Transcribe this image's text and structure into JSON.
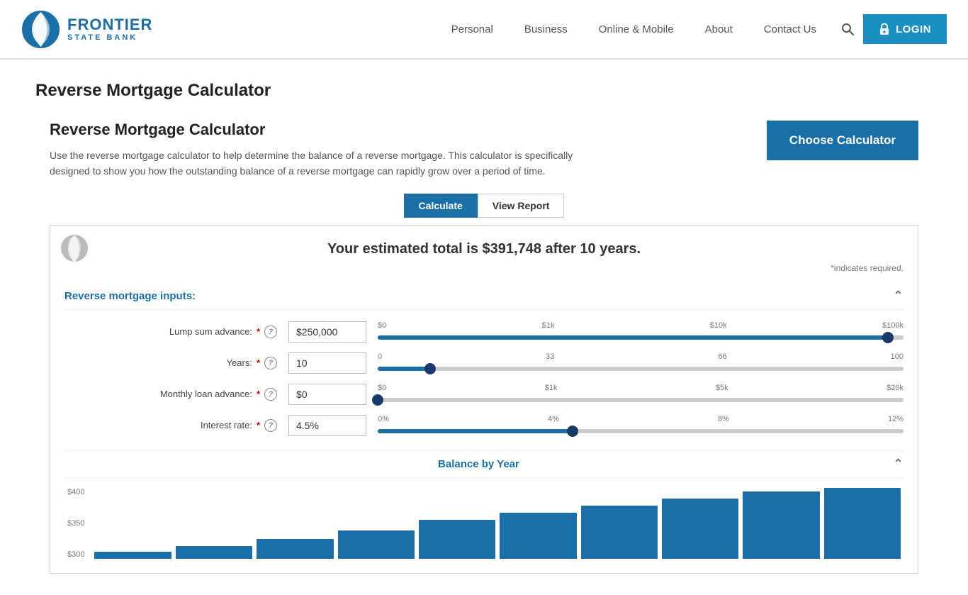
{
  "header": {
    "logo_frontier": "FRONTIER",
    "logo_statebank": "STATE BANK",
    "nav": {
      "personal": "Personal",
      "business": "Business",
      "online_mobile": "Online & Mobile",
      "about": "About",
      "contact_us": "Contact Us"
    },
    "login_label": "LOGIN"
  },
  "page": {
    "title": "Reverse Mortgage Calculator"
  },
  "calculator": {
    "heading": "Reverse Mortgage Calculator",
    "description": "Use the reverse mortgage calculator to help determine the balance of a reverse mortgage. This calculator is specifically designed to show you how the outstanding balance of a reverse mortgage can rapidly grow over a period of time.",
    "choose_btn": "Choose Calculator",
    "tabs": {
      "calculate": "Calculate",
      "view_report": "View Report"
    },
    "estimated_total_text": "Your estimated total is $391,748 after 10 years.",
    "required_note": "*indicates required.",
    "inputs_section_title": "Reverse mortgage inputs:",
    "inputs": [
      {
        "label": "Lump sum advance:",
        "required": true,
        "value": "$250,000",
        "slider_labels": [
          "$0",
          "$1k",
          "$10k",
          "$100k"
        ],
        "slider_fill_pct": 97,
        "thumb_pct": 97
      },
      {
        "label": "Years:",
        "required": true,
        "value": "10",
        "slider_labels": [
          "0",
          "33",
          "66",
          "100"
        ],
        "slider_fill_pct": 10,
        "thumb_pct": 10
      },
      {
        "label": "Monthly loan advance:",
        "required": true,
        "value": "$0",
        "slider_labels": [
          "$0",
          "$1k",
          "$5k",
          "$20k"
        ],
        "slider_fill_pct": 0,
        "thumb_pct": 0
      },
      {
        "label": "Interest rate:",
        "required": true,
        "value": "4.5%",
        "slider_labels": [
          "0%",
          "4%",
          "8%",
          "12%"
        ],
        "slider_fill_pct": 37,
        "thumb_pct": 37
      }
    ],
    "balance_section_title": "Balance by Year",
    "chart": {
      "y_labels": [
        "$400",
        "$350",
        "$300"
      ],
      "bars": [
        10,
        18,
        28,
        40,
        55,
        65,
        75,
        85,
        95,
        100
      ]
    }
  }
}
